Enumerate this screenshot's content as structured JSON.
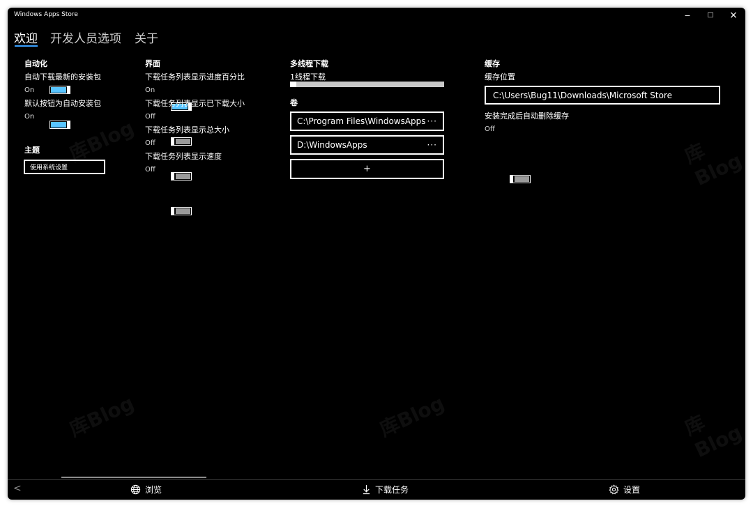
{
  "window": {
    "title": "Windows Apps Store",
    "minimize": "−",
    "maximize": "☐",
    "close": "×"
  },
  "tabs": [
    {
      "label": "欢迎"
    },
    {
      "label": "开发人员选项"
    },
    {
      "label": "关于"
    }
  ],
  "automation": {
    "title": "自动化",
    "auto_download_label": "自动下载最新的安装包",
    "auto_download_state": "On",
    "default_button_label": "默认按钮为自动安装包",
    "default_button_state": "On"
  },
  "theme": {
    "title": "主题",
    "selected": "使用系统设置"
  },
  "interface": {
    "title": "界面",
    "show_progress_label": "下载任务列表显示进度百分比",
    "show_progress_state": "On",
    "show_downloaded_label": "下载任务列表显示已下载大小",
    "show_downloaded_state": "Off",
    "show_total_label": "下载任务列表显示总大小",
    "show_total_state": "Off",
    "show_speed_label": "下载任务列表显示速度",
    "show_speed_state": "Off"
  },
  "multithread": {
    "title": "多线程下载",
    "value_label": "1线程下载",
    "slider_fraction": 0.04
  },
  "volumes": {
    "title": "卷",
    "items": [
      {
        "path": "C:\\Program Files\\WindowsApps"
      },
      {
        "path": "D:\\WindowsApps"
      }
    ],
    "more_glyph": "···",
    "add_label": "+"
  },
  "cache": {
    "title": "缓存",
    "location_label": "缓存位置",
    "location_value": "C:\\Users\\Bug11\\Downloads\\Microsoft Store",
    "auto_delete_label": "安装完成后自动删除缓存",
    "auto_delete_state": "Off"
  },
  "nav": {
    "back": "<",
    "browse": "浏览",
    "downloads": "下载任务",
    "settings": "设置"
  },
  "watermark": "库Blog",
  "colors": {
    "accent": "#58c4ff",
    "background": "#000000",
    "tab_underline": "#3aa0ff"
  }
}
